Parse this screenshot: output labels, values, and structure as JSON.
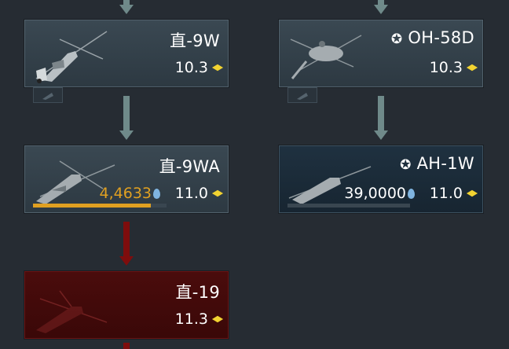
{
  "cards": {
    "zhi9w": {
      "name": "直-9W",
      "br": "10.3"
    },
    "oh58d": {
      "name": "OH-58D",
      "br": "10.3"
    },
    "zhi9wa": {
      "name": "直-9WA",
      "rp": "4,4633",
      "br": "11.0",
      "progress": 0.88
    },
    "ah1w": {
      "name": "AH-1W",
      "rp": "39,0000",
      "br": "11.0",
      "progress": 0.0
    },
    "zhi19": {
      "name": "直-19",
      "br": "11.3"
    }
  },
  "colors": {
    "rp_in_progress": "#e0a021",
    "rp_default": "#ffffff",
    "br_diamond": "#f2d331",
    "locked_card": "#4a0c0c"
  },
  "icons": [
    "helicopter-icon",
    "flag-icon",
    "research-point-icon",
    "br-diamond-icon",
    "arrow-icon"
  ]
}
